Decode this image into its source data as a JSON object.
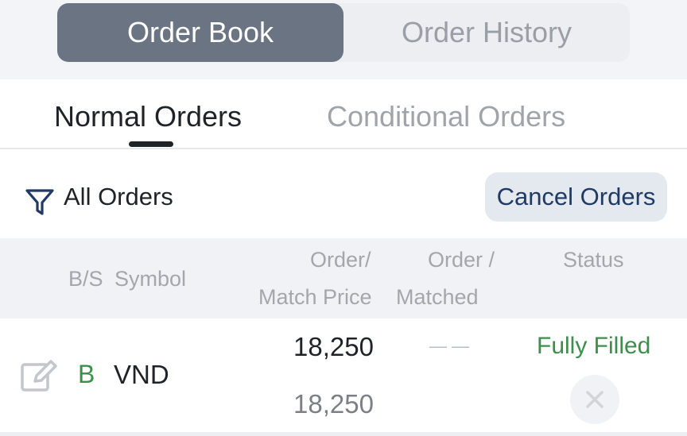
{
  "segment": {
    "order_book": "Order Book",
    "order_history": "Order History"
  },
  "tabs": {
    "normal": "Normal Orders",
    "conditional": "Conditional Orders"
  },
  "filter": {
    "label": "All Orders",
    "cancel": "Cancel Orders"
  },
  "table": {
    "headers": {
      "bs": "B/S",
      "symbol": "Symbol",
      "order_line1": "Order/",
      "order_line2": "Match Price",
      "vol_line1": "Order /",
      "vol_line2": "Matched",
      "status": "Status"
    },
    "rows": [
      {
        "side": "B",
        "symbol": "VND",
        "order_price": "18,250",
        "match_price": "18,250",
        "volume": "— —",
        "status": "Fully Filled"
      }
    ]
  },
  "colors": {
    "accent_dark": "#203a63",
    "buy_green": "#3b8f4a",
    "segment_active": "#6b7482"
  },
  "icons": {
    "filter": "filter-icon",
    "edit": "edit-icon",
    "close": "close-icon"
  }
}
